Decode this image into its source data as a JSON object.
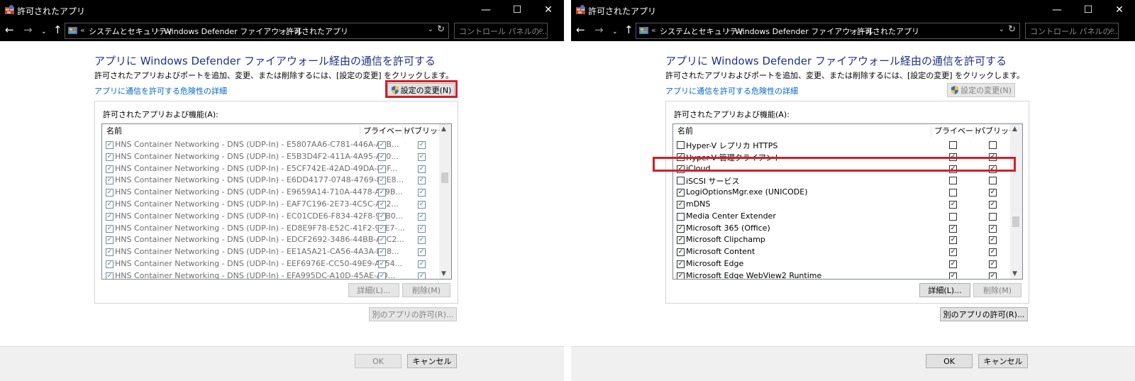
{
  "colors": {
    "highlight": "#d0202a",
    "heading": "#1e3287",
    "link": "#0066cc",
    "titlebar": "#000000"
  },
  "window": {
    "title": "許可されたアプリ",
    "controls": {
      "minimize": "—",
      "maximize": "☐",
      "close": "✕"
    }
  },
  "address": {
    "back": "←",
    "forward": "→",
    "dropdown": "⌄",
    "up": "↑",
    "prefix": "«",
    "crumbs": [
      "システムとセキュリティ",
      "Windows Defender ファイアウォール",
      "許可されたアプリ"
    ],
    "separator": "›",
    "search_placeholder": "コントロール パネルの...",
    "search_icon": "search-icon"
  },
  "page": {
    "heading": "アプリに Windows Defender ファイアウォール経由の通信を許可する",
    "description": "許可されたアプリおよびポートを追加、変更、または削除するには、[設定の変更] をクリックします。",
    "risk_link": "アプリに通信を許可する危険性の詳細",
    "change_settings": "設定の変更(N)",
    "group_label": "許可されたアプリおよび機能(A):",
    "col_name": "名前",
    "col_private": "プライベート",
    "col_public": "パブリック",
    "details": "詳細(L)...",
    "remove": "削除(M)",
    "allow_another": "別のアプリの許可(R)...",
    "ok": "OK",
    "cancel": "キャンセル"
  },
  "left_list": [
    {
      "name": "HNS Container Networking - DNS (UDP-In) - E5807AA6-C781-446A-A1B...",
      "checked": true,
      "private": true,
      "public": true
    },
    {
      "name": "HNS Container Networking - DNS (UDP-In) - E5B3D4F2-411A-4A95-A60...",
      "checked": true,
      "private": true,
      "public": true
    },
    {
      "name": "HNS Container Networking - DNS (UDP-In) - E5CF742E-42AD-49DA-88F...",
      "checked": true,
      "private": true,
      "public": true
    },
    {
      "name": "HNS Container Networking - DNS (UDP-In) - E6DD4177-0748-4769-80E8...",
      "checked": true,
      "private": true,
      "public": true
    },
    {
      "name": "HNS Container Networking - DNS (UDP-In) - E9659A14-710A-4478-A69B...",
      "checked": true,
      "private": true,
      "public": true
    },
    {
      "name": "HNS Container Networking - DNS (UDP-In) - EAF7C196-2E73-4C5C-AC2...",
      "checked": true,
      "private": true,
      "public": true
    },
    {
      "name": "HNS Container Networking - DNS (UDP-In) - EC01CDE6-F834-42F8-98B0...",
      "checked": true,
      "private": true,
      "public": true
    },
    {
      "name": "HNS Container Networking - DNS (UDP-In) - ED8E9F78-E52C-41F2-99E7-...",
      "checked": true,
      "private": true,
      "public": true
    },
    {
      "name": "HNS Container Networking - DNS (UDP-In) - EDCF2692-3486-44BB-A6C2...",
      "checked": true,
      "private": true,
      "public": true
    },
    {
      "name": "HNS Container Networking - DNS (UDP-In) - EE1A5A21-CA56-4A3A-B08...",
      "checked": true,
      "private": true,
      "public": true
    },
    {
      "name": "HNS Container Networking - DNS (UDP-In) - EEF6976E-CC50-49E9-A654...",
      "checked": true,
      "private": true,
      "public": true
    },
    {
      "name": "HNS Container Networking - DNS (UDP-In) - EFA995DC-A10D-45AE-AD...",
      "checked": true,
      "private": true,
      "public": true
    }
  ],
  "right_list": [
    {
      "name": "Hyper-V レプリカ HTTPS",
      "checked": false,
      "private": false,
      "public": false
    },
    {
      "name": "Hyper-V 管理クライアント",
      "checked": true,
      "private": true,
      "public": true
    },
    {
      "name": "iCloud",
      "checked": true,
      "private": true,
      "public": true
    },
    {
      "name": "iSCSI サービス",
      "checked": false,
      "private": false,
      "public": false
    },
    {
      "name": "LogiOptionsMgr.exe (UNICODE)",
      "checked": true,
      "private": false,
      "public": true
    },
    {
      "name": "mDNS",
      "checked": true,
      "private": true,
      "public": true
    },
    {
      "name": "Media Center Extender",
      "checked": false,
      "private": false,
      "public": false
    },
    {
      "name": "Microsoft 365 (Office)",
      "checked": true,
      "private": true,
      "public": true
    },
    {
      "name": "Microsoft Clipchamp",
      "checked": true,
      "private": true,
      "public": true
    },
    {
      "name": "Microsoft Content",
      "checked": true,
      "private": true,
      "public": true
    },
    {
      "name": "Microsoft Edge",
      "checked": true,
      "private": true,
      "public": true
    },
    {
      "name": "Microsoft Edge WebView2 Runtime",
      "checked": true,
      "private": true,
      "public": true
    }
  ]
}
